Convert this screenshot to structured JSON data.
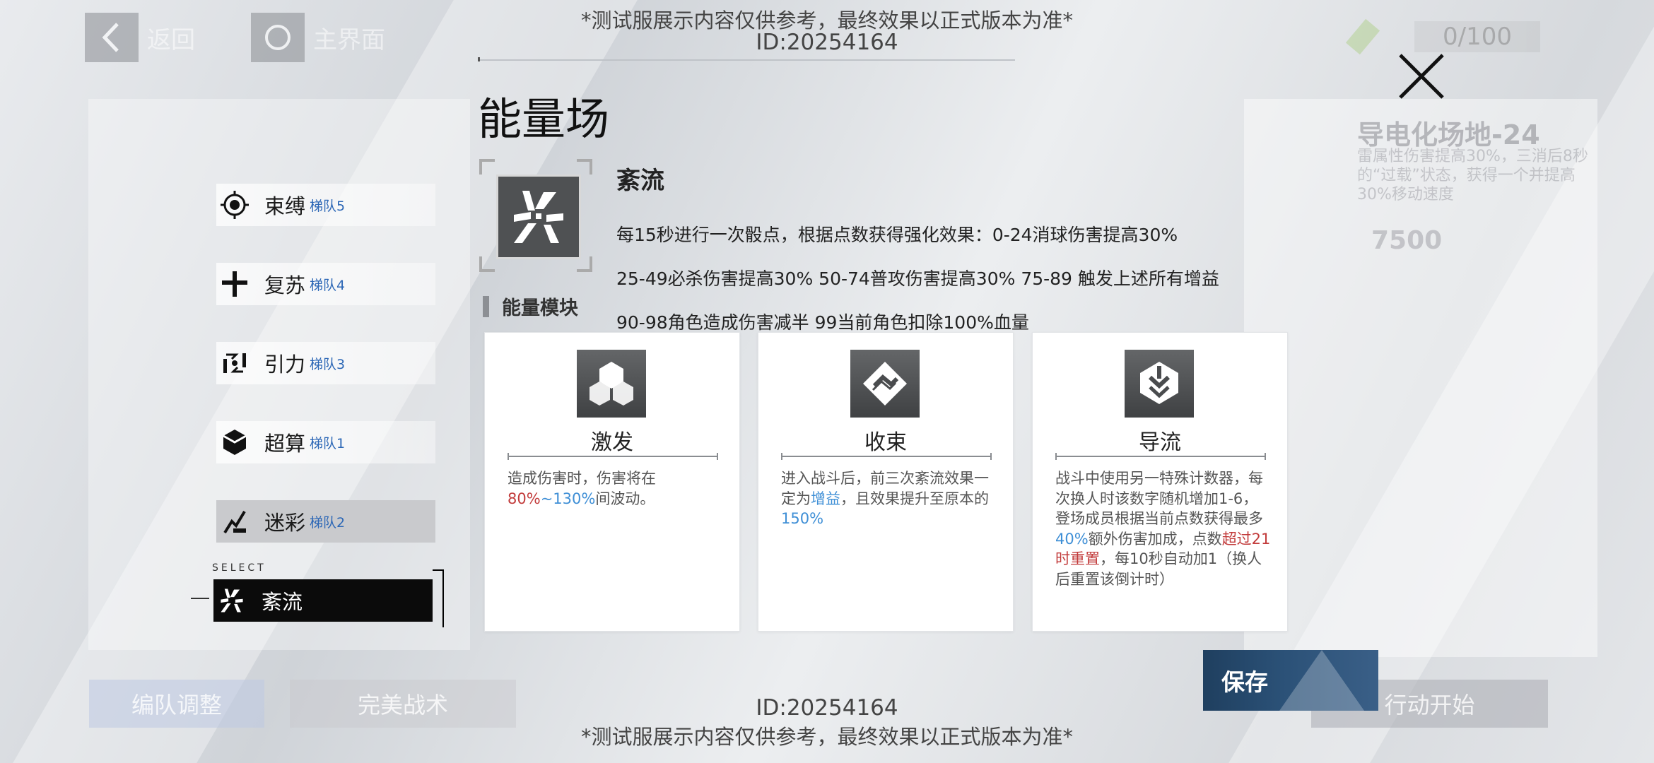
{
  "watermark": {
    "top_notice": "*测试服展示内容仅供参考，最终效果以正式版本为准*",
    "top_id": "ID:20254164",
    "bottom_id": "ID:20254164",
    "bottom_notice": "*测试服展示内容仅供参考，最终效果以正式版本为准*"
  },
  "background": {
    "back_label": "返回",
    "home_label": "主界面",
    "counter": "0/100",
    "right_panel_title": "导电化场地-24",
    "right_panel_desc": "雷属性伤害提高30%，三消后8秒的“过载”状态，获得一个并提高30%移动速度",
    "right_panel_number": "7500",
    "formation_button": "编队调整",
    "tactics_button": "完美战术",
    "start_button": "行动开始"
  },
  "modal": {
    "title": "能量场",
    "field": {
      "name": "紊流",
      "desc_line1": "每15秒进行一次骰点，根据点数获得强化效果：0-24消球伤害提高30%",
      "desc_line2": "25-49必杀伤害提高30% 50-74普攻伤害提高30% 75-89 触发上述所有增益",
      "desc_line3": "90-98角色造成伤害减半 99当前角色扣除100%血量"
    },
    "section_title": "能量模块",
    "modules": [
      {
        "name": "激发",
        "icon": "hexagons-icon",
        "desc_a": "造成伤害时，伤害将在",
        "desc_hl1": "80%",
        "desc_b": "~",
        "desc_hl2": "130%",
        "desc_c": "间波动。"
      },
      {
        "name": "收束",
        "icon": "diamond-swirl-icon",
        "desc_a": "进入战斗后，前三次紊流效果一定为",
        "desc_hl1": "增益",
        "desc_b": "，且效果提升至原本的",
        "desc_hl2": "150%"
      },
      {
        "name": "导流",
        "icon": "download-chevron-icon",
        "desc_a": "战斗中使用另一特殊计数器，每次换人时该数字随机增加1-6，登场成员根据当前点数获得最多",
        "desc_hl1": "40%",
        "desc_b": "额外伤害加成，点数",
        "desc_hl2": "超过21时重置",
        "desc_c": "，每10秒自动加1（换人后重置该倒计时）"
      }
    ],
    "save_label": "保存"
  },
  "field_list": {
    "select_label": "SELECT",
    "items": [
      {
        "name": "束缚",
        "tag": "梯队5",
        "icon": "target-icon"
      },
      {
        "name": "复苏",
        "tag": "梯队4",
        "icon": "plus-cross-icon"
      },
      {
        "name": "引力",
        "tag": "梯队3",
        "icon": "gravity-icon"
      },
      {
        "name": "超算",
        "tag": "梯队1",
        "icon": "cube-icon"
      },
      {
        "name": "迷彩",
        "tag": "梯队2",
        "icon": "camo-icon"
      },
      {
        "name": "紊流",
        "tag": "",
        "icon": "turbulence-icon"
      }
    ]
  }
}
